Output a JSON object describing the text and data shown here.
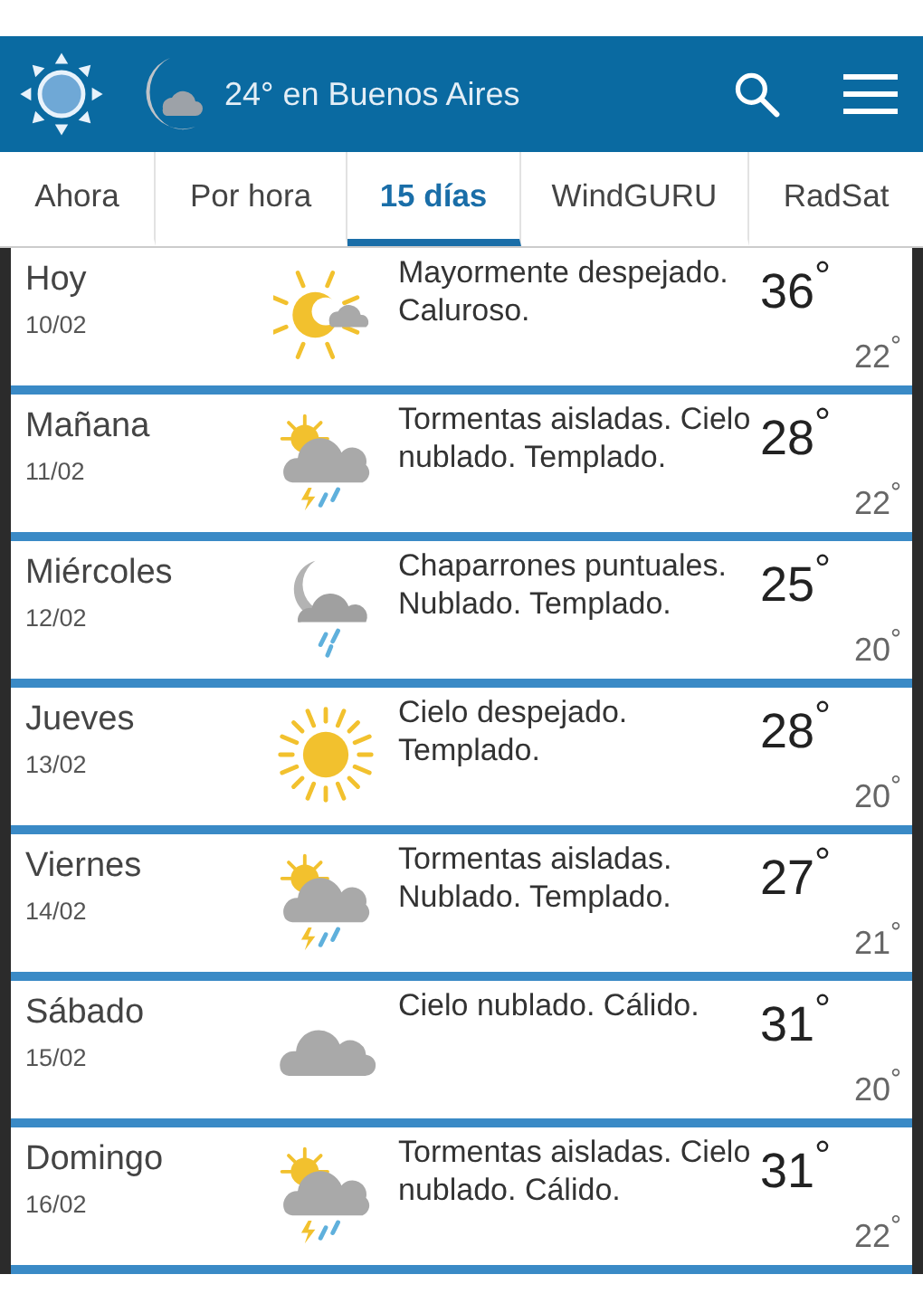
{
  "header": {
    "title": "24° en Buenos Aires"
  },
  "tabs": [
    {
      "label": "Ahora",
      "selected": false
    },
    {
      "label": "Por hora",
      "selected": false
    },
    {
      "label": "15 días",
      "selected": true
    },
    {
      "label": "WindGURU",
      "selected": false
    },
    {
      "label": "RadSat",
      "selected": false
    }
  ],
  "days": [
    {
      "day": "Hoy",
      "date": "10/02",
      "kind": "sun-cloud",
      "description": "Mayormente despejado. Caluroso.",
      "high": "36$^{°}$",
      "low": "22$^{°}$"
    },
    {
      "day": "Mañana",
      "date": "11/02",
      "kind": "storm",
      "description": "Tormentas aisladas. Cielo nublado. Templado.",
      "high": "28$^{°}$",
      "low": "22$^{°}$"
    },
    {
      "day": "Miércoles",
      "date": "12/02",
      "kind": "moon-rain",
      "description": "Chaparrones puntuales. Nublado. Templado.",
      "high": "25$^{°}$",
      "low": "20$^{°}$"
    },
    {
      "day": "Jueves",
      "date": "13/02",
      "kind": "sun",
      "description": "Cielo despejado. Templado.",
      "high": "28$^{°}$",
      "low": "20$^{°}$"
    },
    {
      "day": "Viernes",
      "date": "14/02",
      "kind": "storm",
      "description": "Tormentas aisladas. Nublado. Templado.",
      "high": "27$^{°}$",
      "low": "21$^{°}$"
    },
    {
      "day": "Sábado",
      "date": "15/02",
      "kind": "cloud",
      "description": "Cielo nublado. Cálido.",
      "high": "31$^{°}$",
      "low": "20$^{°}$"
    },
    {
      "day": "Domingo",
      "date": "16/02",
      "kind": "storm",
      "description": "Tormentas aisladas. Cielo nublado. Cálido.",
      "high": "31$^{°}$",
      "low": "22$^{°}$"
    }
  ]
}
